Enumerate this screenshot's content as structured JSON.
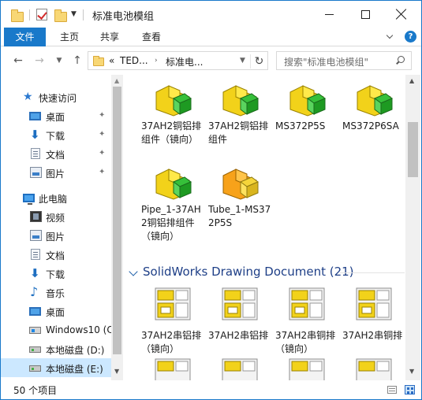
{
  "window": {
    "title": "标准电池模组",
    "accent": "#1979ca"
  },
  "ribbon": {
    "tabs": [
      {
        "label": "文件"
      },
      {
        "label": "主页"
      },
      {
        "label": "共享"
      },
      {
        "label": "查看"
      }
    ],
    "help_label": "?"
  },
  "address": {
    "prefix": "«",
    "segments": [
      "TED...",
      "标准电..."
    ],
    "search_placeholder": "搜索\"标准电池模组\""
  },
  "nav": {
    "quick_access": "快速访问",
    "quick_items": [
      {
        "label": "桌面",
        "icon": "desktop-icon",
        "pinned": true
      },
      {
        "label": "下载",
        "icon": "download-icon",
        "pinned": true
      },
      {
        "label": "文档",
        "icon": "document-icon",
        "pinned": true
      },
      {
        "label": "图片",
        "icon": "pictures-icon",
        "pinned": true
      }
    ],
    "this_pc": "此电脑",
    "pc_items": [
      {
        "label": "视频",
        "icon": "video-icon"
      },
      {
        "label": "图片",
        "icon": "pictures-icon"
      },
      {
        "label": "文档",
        "icon": "document-icon"
      },
      {
        "label": "下载",
        "icon": "download-icon"
      },
      {
        "label": "音乐",
        "icon": "music-icon"
      },
      {
        "label": "桌面",
        "icon": "desktop-icon"
      },
      {
        "label": "Windows10 (C",
        "icon": "windows-drive-icon"
      },
      {
        "label": "本地磁盘 (D:)",
        "icon": "drive-icon"
      },
      {
        "label": "本地磁盘 (E:)",
        "icon": "drive-icon",
        "selected": true
      }
    ],
    "pin_glyph": "📌"
  },
  "content": {
    "part_files": [
      {
        "name": "37AH2铜铝排组件（镜向）"
      },
      {
        "name": "37AH2铜铝排组件"
      },
      {
        "name": "MS372P5S"
      },
      {
        "name": "MS372P6SA"
      },
      {
        "name": "Pipe_1-37AH2铜铝排组件（镜向）"
      },
      {
        "name": "Tube_1-MS372P5S"
      }
    ],
    "group_title": "SolidWorks Drawing Document (21)",
    "drawing_files": [
      {
        "name": "37AH2串铝排（镜向）"
      },
      {
        "name": "37AH2串铝排"
      },
      {
        "name": "37AH2串铜排（镜向）"
      },
      {
        "name": "37AH2串铜排"
      }
    ]
  },
  "status": {
    "item_count": "50 个项目"
  }
}
